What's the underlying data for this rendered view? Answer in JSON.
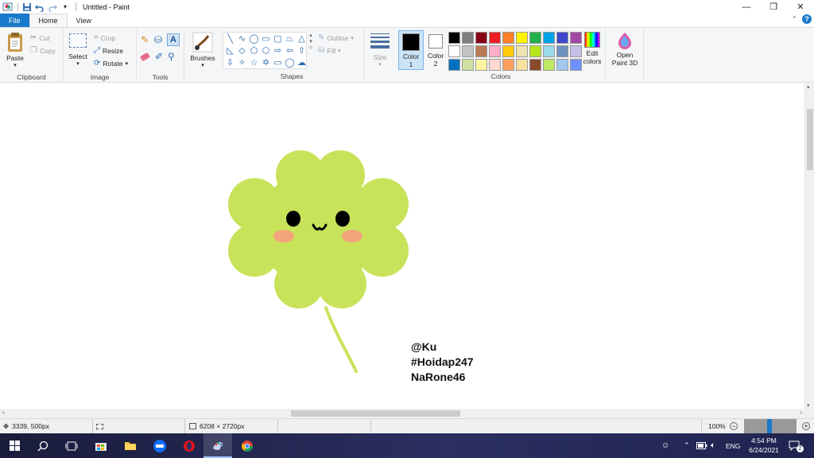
{
  "window": {
    "title": "Untitled - Paint",
    "minimize_glyph": "—",
    "maximize_glyph": "❐",
    "close_glyph": "✕"
  },
  "tabs": [
    {
      "label": "File"
    },
    {
      "label": "Home"
    },
    {
      "label": "View"
    }
  ],
  "ribbon": {
    "clipboard": {
      "paste": "Paste",
      "cut": "Cut",
      "copy": "Copy",
      "group": "Clipboard"
    },
    "image": {
      "select": "Select",
      "crop": "Crop",
      "resize": "Resize",
      "rotate": "Rotate",
      "group": "Image"
    },
    "tools": {
      "group": "Tools"
    },
    "brushes": {
      "label": "Brushes"
    },
    "shapes": {
      "outline": "Outline",
      "fill": "Fill",
      "group": "Shapes"
    },
    "size": {
      "label": "Size"
    },
    "colors": {
      "color1_label": "Color",
      "color1_num": "1",
      "color2_label": "Color",
      "color2_num": "2",
      "color1_value": "#000000",
      "color2_value": "#ffffff",
      "edit_label_1": "Edit",
      "edit_label_2": "colors",
      "group": "Colors",
      "palette": [
        "#000000",
        "#7f7f7f",
        "#880015",
        "#ed1c24",
        "#ff7f27",
        "#fff200",
        "#22b14c",
        "#00a2e8",
        "#3f48cc",
        "#a349a4",
        "#ffffff",
        "#c3c3c3",
        "#b97a57",
        "#ffaec9",
        "#ffc90e",
        "#efe4b0",
        "#b5e61d",
        "#99d9ea",
        "#7092be",
        "#c8bfe7",
        "#0070c0",
        "#d0e0a0",
        "#fff5a0",
        "#ffd8d0",
        "#ffa060",
        "#f8e0a0",
        "#8b4a2b",
        "#c0e860",
        "#a0c8f0",
        "#7090ff"
      ]
    },
    "paint3d": {
      "line1": "Open",
      "line2": "Paint 3D"
    }
  },
  "canvas": {
    "signature_lines": [
      "@Ku",
      "#Hoidap247",
      "NaRone46"
    ],
    "clover_color": "#c8e35a",
    "cheek_color": "#f4a47a"
  },
  "status": {
    "cursor_pos": "3339, 500px",
    "canvas_size": "6208 × 2720px",
    "zoom": "100%"
  },
  "taskbar": {
    "lang": "ENG",
    "time": "4:54 PM",
    "date": "6/24/2021",
    "notifications": "2"
  }
}
